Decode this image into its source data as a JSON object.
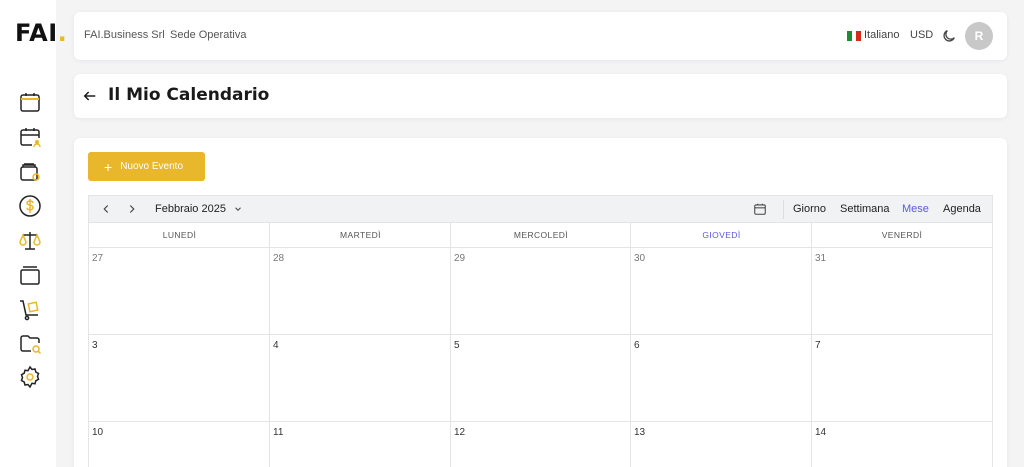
{
  "sidebar": {
    "logo_text": "FAI",
    "logo_dot": ".",
    "items": [
      {
        "icon": "calendar-icon"
      },
      {
        "icon": "calendar-user-icon"
      },
      {
        "icon": "wallet-icon"
      },
      {
        "icon": "dollar-icon"
      },
      {
        "icon": "scales-icon"
      },
      {
        "icon": "stack-icon"
      },
      {
        "icon": "hand-truck-icon"
      },
      {
        "icon": "folder-search-icon"
      },
      {
        "icon": "gear-icon"
      }
    ],
    "accent": "#e9b72b"
  },
  "header": {
    "company": "FAI.Business Srl",
    "location": "Sede Operativa",
    "language": "Italiano",
    "currency": "USD",
    "avatar_initial": "R"
  },
  "page": {
    "title": "Il Mio Calendario"
  },
  "calendar": {
    "new_event_label": "Nuovo Evento",
    "current_month": "Febbraio 2025",
    "views": [
      "Giorno",
      "Settimana",
      "Mese",
      "Agenda"
    ],
    "active_view": "Mese",
    "weekdays": [
      "LUNEDÌ",
      "MARTEDÌ",
      "MERCOLEDÌ",
      "GIOVEDÌ",
      "VENERDÌ"
    ],
    "today_weekday": "GIOVEDÌ",
    "weeks": [
      [
        "27",
        "28",
        "29",
        "30",
        "31"
      ],
      [
        "3",
        "4",
        "5",
        "6",
        "7"
      ],
      [
        "10",
        "11",
        "12",
        "13",
        "14"
      ]
    ]
  },
  "colors": {
    "accent": "#e9b72b",
    "active_view": "#5b5bd6",
    "background": "#f4f4f5"
  }
}
